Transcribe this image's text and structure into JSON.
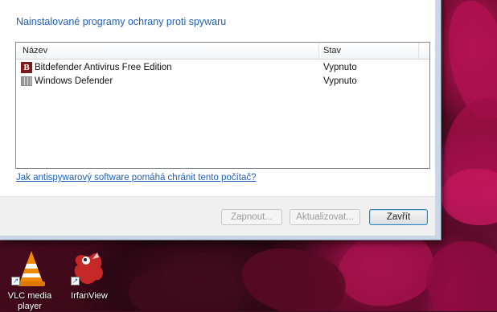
{
  "dialog": {
    "heading": "Nainstalované programy ochrany proti spywaru",
    "columns": {
      "name": "Název",
      "status": "Stav"
    },
    "programs": [
      {
        "name": "Bitdefender Antivirus Free Edition",
        "status": "Vypnuto",
        "icon": "bitdefender-icon"
      },
      {
        "name": "Windows Defender",
        "status": "Vypnuto",
        "icon": "windows-defender-icon"
      }
    ],
    "help_link": "Jak antispywarový software pomáhá chránit tento počítač?",
    "buttons": {
      "enable": "Zapnout...",
      "update": "Aktualizovat...",
      "close": "Zavřít"
    }
  },
  "desktop": {
    "icons": [
      {
        "label": "VLC media player",
        "icon": "vlc-cone-icon"
      },
      {
        "label": "IrfanView",
        "icon": "irfanview-icon"
      }
    ]
  },
  "colors": {
    "heading": "#1e5fb5",
    "link": "#1e5fb5",
    "wallpaper": "#6d1034"
  }
}
